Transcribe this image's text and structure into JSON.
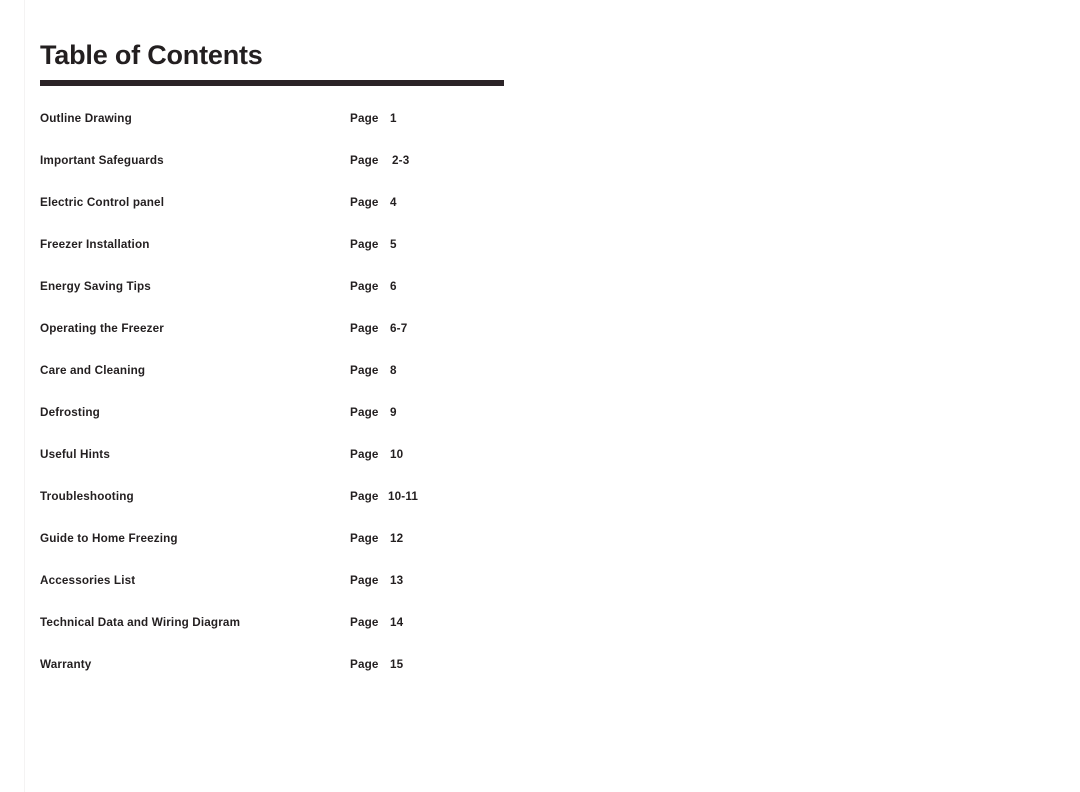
{
  "document": {
    "title": "Table of Contents",
    "page_label": "Page",
    "colors": {
      "text": "#231f20",
      "rule": "#2b2327",
      "background": "#ffffff"
    },
    "entries": [
      {
        "title": "Outline Drawing",
        "page_label": "Page",
        "page": "1",
        "style": ""
      },
      {
        "title": "Important Safeguards",
        "page_label": "Page",
        "page": "2-3",
        "style": "indent-range"
      },
      {
        "title": "Electric Control panel",
        "page_label": "Page",
        "page": "4",
        "style": ""
      },
      {
        "title": "Freezer Installation",
        "page_label": "Page",
        "page": "5",
        "style": ""
      },
      {
        "title": "Energy Saving Tips",
        "page_label": "Page",
        "page": "6",
        "style": ""
      },
      {
        "title": "Operating the Freezer",
        "page_label": "Page",
        "page": "6-7",
        "style": ""
      },
      {
        "title": "Care and Cleaning",
        "page_label": "Page",
        "page": "8",
        "style": ""
      },
      {
        "title": "Defrosting",
        "page_label": "Page",
        "page": "9",
        "style": ""
      },
      {
        "title": "Useful Hints",
        "page_label": "Page",
        "page": "10",
        "style": ""
      },
      {
        "title": "Troubleshooting",
        "page_label": "Page",
        "page": "10-11",
        "style": "wide-range"
      },
      {
        "title": "Guide to Home Freezing",
        "page_label": "Page",
        "page": "12",
        "style": ""
      },
      {
        "title": "Accessories List",
        "page_label": "Page",
        "page": "13",
        "style": ""
      },
      {
        "title": "Technical Data and Wiring Diagram",
        "page_label": "Page",
        "page": "14",
        "style": ""
      },
      {
        "title": "Warranty",
        "page_label": "Page",
        "page": "15",
        "style": ""
      }
    ]
  }
}
